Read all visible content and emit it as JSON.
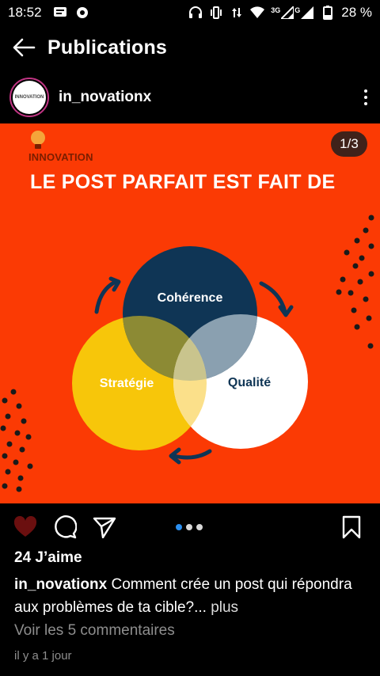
{
  "status_bar": {
    "time": "18:52",
    "network": "3G",
    "network_sub": "G",
    "battery": "28 %"
  },
  "app_bar": {
    "title": "Publications"
  },
  "post": {
    "username": "in_novationx",
    "avatar_text": "INNOVATION",
    "image": {
      "counter": "1/3",
      "brand": "INNOVATION",
      "headline": "LE POST PARFAIT EST FAIT DE",
      "circles": {
        "top": "Cohérence",
        "left": "Stratégie",
        "right": "Qualité"
      },
      "colors": {
        "background": "#fb3a04",
        "top_circle": "#0f3555",
        "left_circle": "#f7c60a",
        "right_circle": "#ffffff"
      }
    },
    "carousel": {
      "count": 3,
      "active": 1
    },
    "likes": "24 J’aime",
    "caption": {
      "user": "in_novationx",
      "text": "Comment crée un post qui répondra aux problèmes de ta cible?...",
      "more": "plus"
    },
    "comments_link": "Voir les 5 commentaires",
    "time_ago": "il y a 1 jour"
  },
  "icons": {
    "back": "arrow-left-icon",
    "more": "more-vertical-icon",
    "like": "heart-icon",
    "comment": "comment-icon",
    "share": "send-icon",
    "save": "bookmark-icon"
  }
}
